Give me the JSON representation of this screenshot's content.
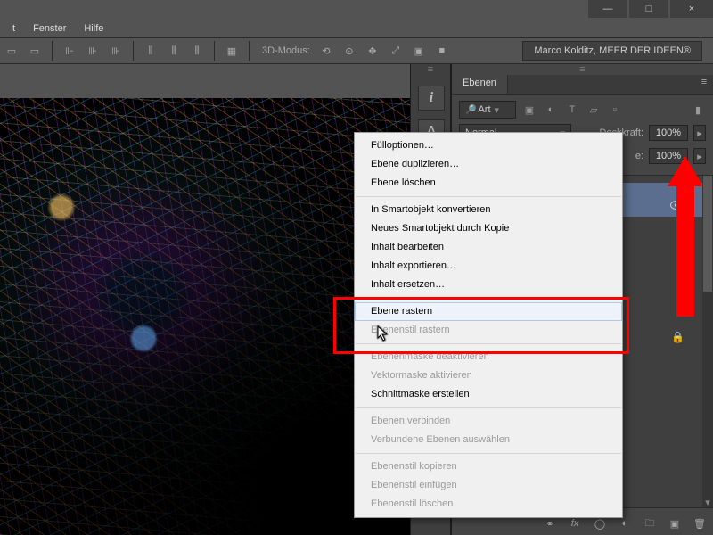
{
  "menubar": {
    "fenster": "Fenster",
    "hilfe": "Hilfe"
  },
  "window_controls": {
    "min": "—",
    "max": "□",
    "close": "×"
  },
  "optbar": {
    "mode3d_label": "3D-Modus:"
  },
  "brand": "Marco Kolditz, MEER DER IDEEN®",
  "panel": {
    "tab_ebenen": "Ebenen",
    "kind_label": "Art",
    "blend_mode": "Normal",
    "opacity_label": "Deckkraft:",
    "opacity_value": "100%",
    "fill_value": "100%"
  },
  "ctx": {
    "fulloptionen": "Fülloptionen…",
    "duplizieren": "Ebene duplizieren…",
    "loeschen": "Ebene löschen",
    "smart_konv": "In Smartobjekt konvertieren",
    "smart_kopie": "Neues Smartobjekt durch Kopie",
    "inhalt_bearb": "Inhalt bearbeiten",
    "inhalt_export": "Inhalt exportieren…",
    "inhalt_ersetzen": "Inhalt ersetzen…",
    "ebene_rastern": "Ebene rastern",
    "ebenenstil_rastern": "Ebenenstil rastern",
    "maske_deakt": "Ebenenmaske deaktivieren",
    "vektormaske_akt": "Vektormaske aktivieren",
    "schnittmaske": "Schnittmaske erstellen",
    "verbinden": "Ebenen verbinden",
    "verbundene_ausw": "Verbundene Ebenen auswählen",
    "stil_kopieren": "Ebenenstil kopieren",
    "stil_einfuegen": "Ebenenstil einfügen",
    "stil_loeschen": "Ebenenstil löschen"
  }
}
